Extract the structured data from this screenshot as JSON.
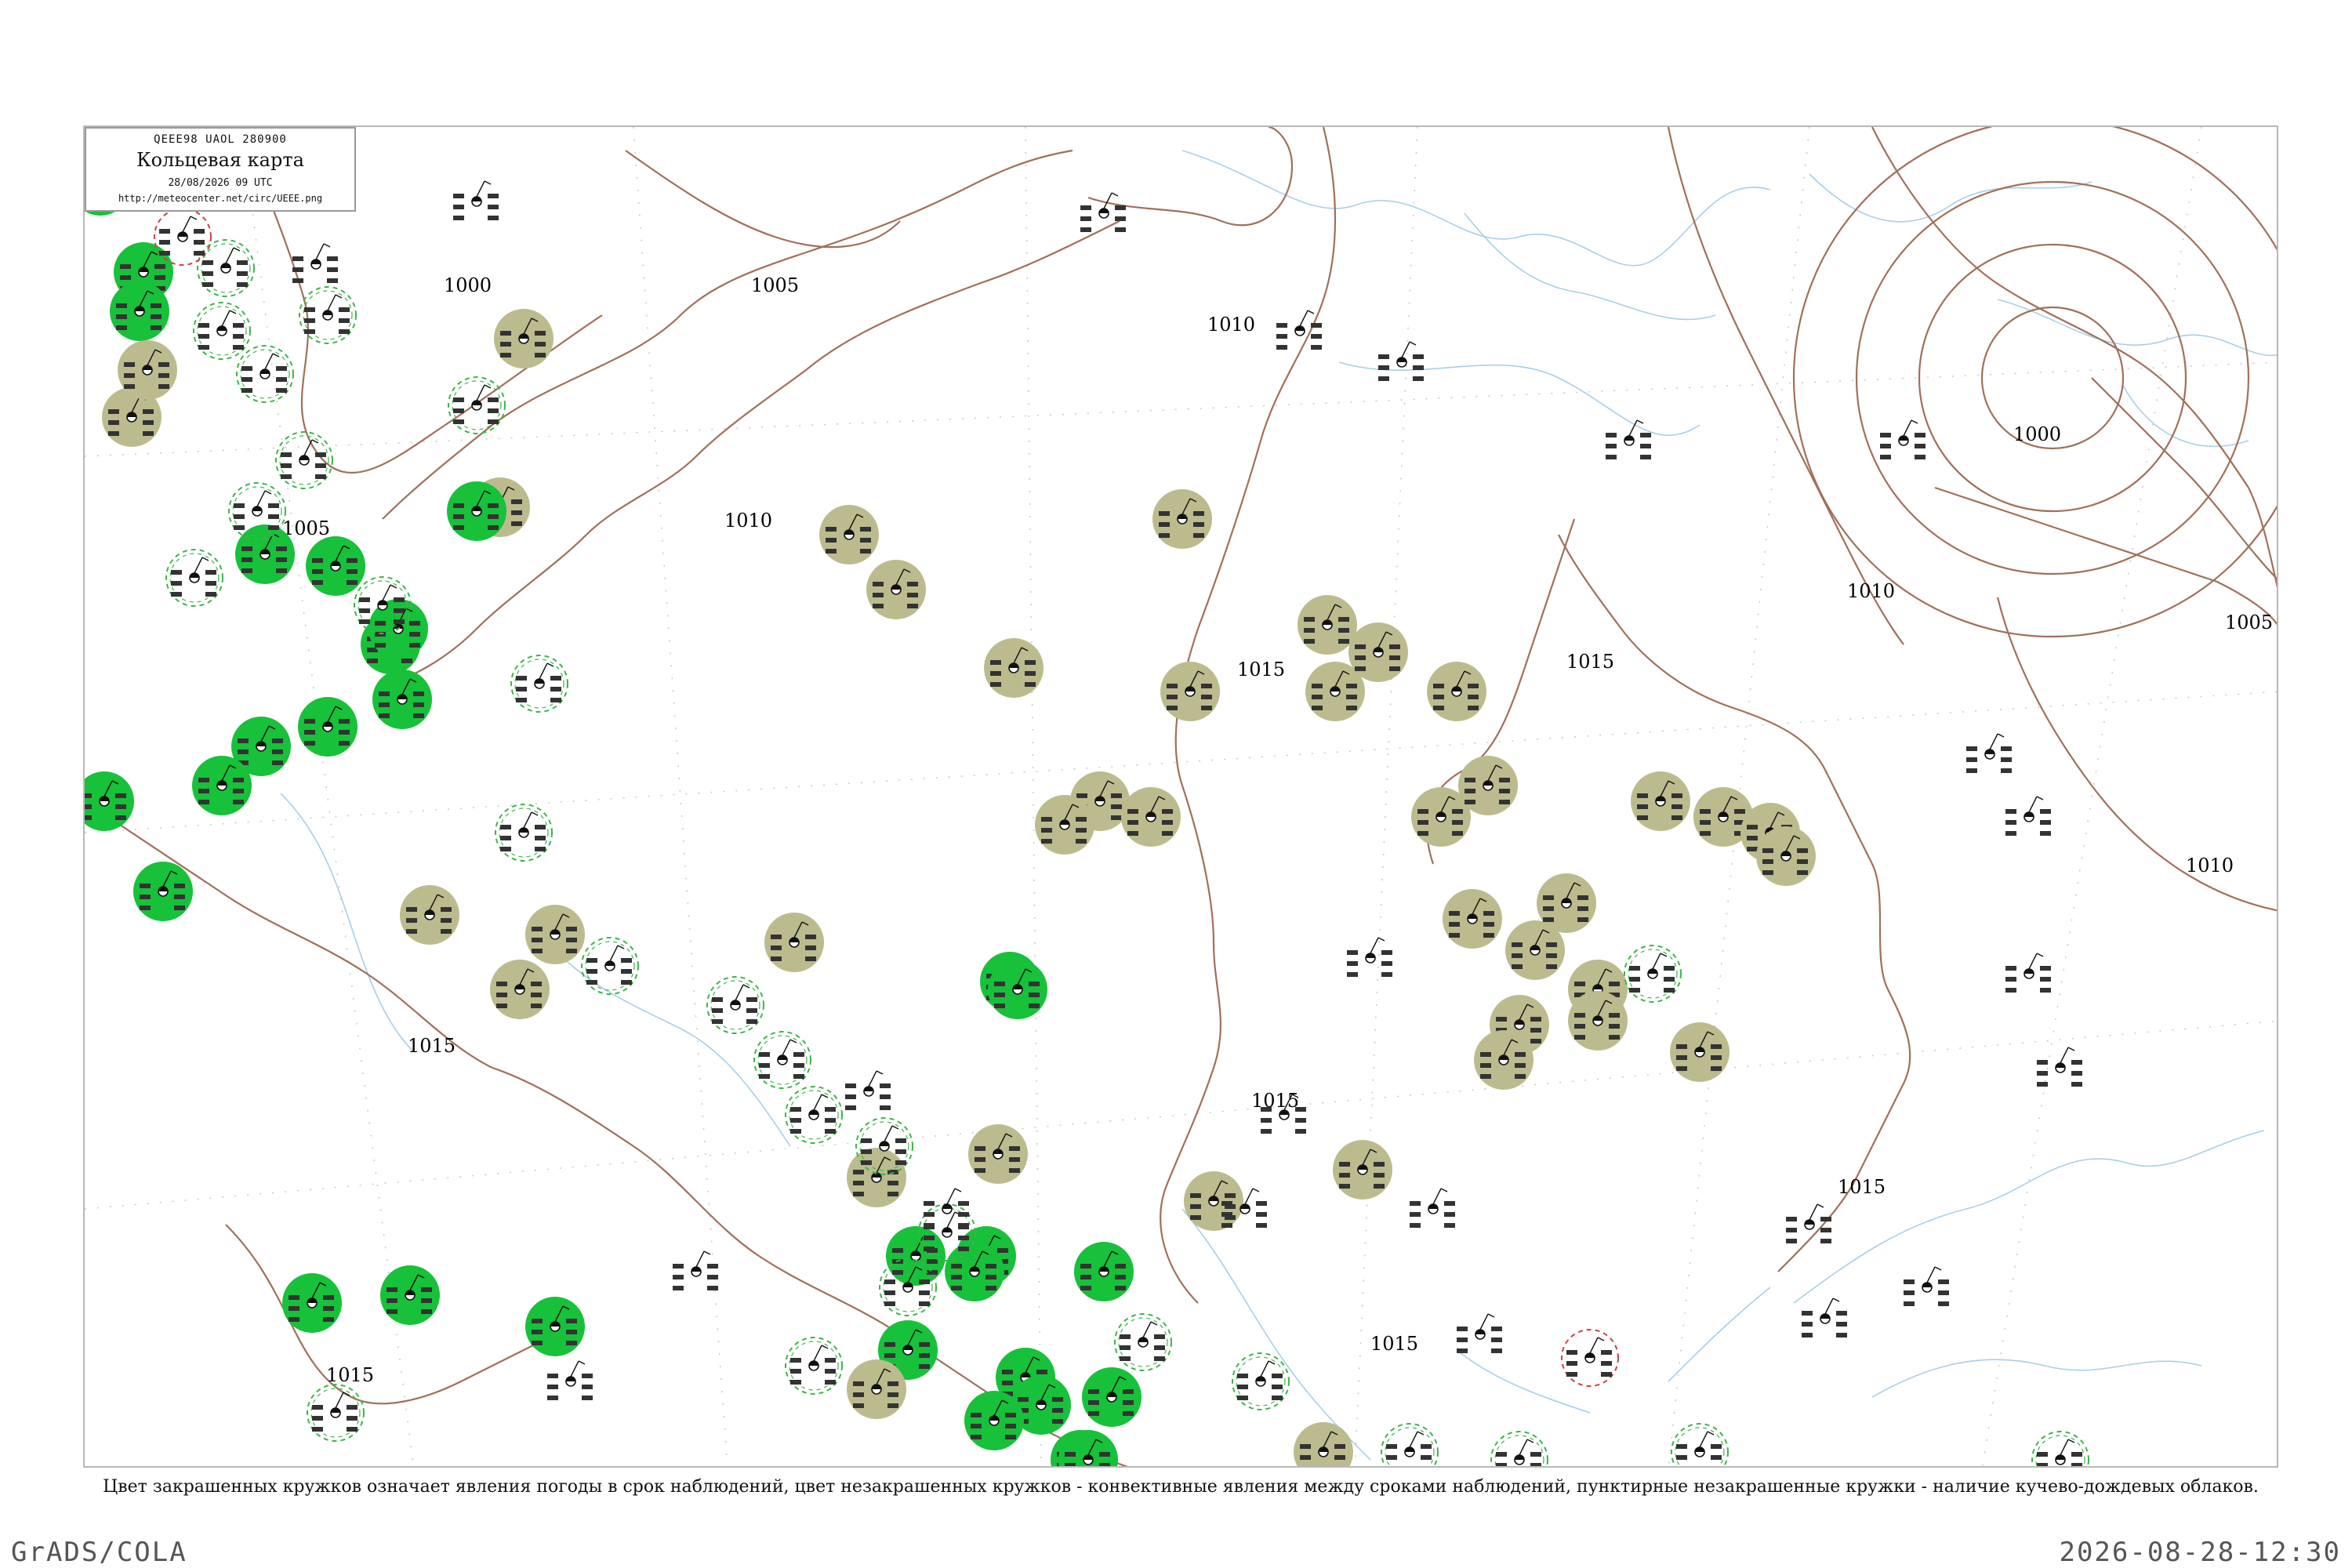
{
  "legend": {
    "code": "QEEE98  UAOL  280900",
    "title": "Кольцевая карта",
    "date": "28/08/2026 09 UTC",
    "url": "http://meteocenter.net/circ/UEEE.png"
  },
  "caption": "Цвет закрашенных кружков означает явления погоды в срок наблюдений, цвет незакрашенных кружков - конвективные явления между сроками наблюдений, пунктирные незакрашенные кружки - наличие кучево-дождевых облаков.",
  "footer": {
    "left": "GrADS/COLA",
    "right": "2026-08-28-12:30"
  },
  "colors": {
    "isobar": "#a0705a",
    "coast": "#a8cfe8",
    "filled_green": "#17c13a",
    "filled_olive": "#bcbb8e",
    "dashed_ring": "#3cb54a",
    "alert_ring": "#d04040",
    "graticule": "#c8c8c8"
  },
  "isobar_labels": [
    "1000",
    "1005",
    "1010",
    "1015"
  ],
  "stations": [
    {
      "kind": "filled_green"
    },
    {
      "kind": "filled_green"
    },
    {
      "kind": "filled_green"
    },
    {
      "kind": "filled_olive"
    },
    {
      "kind": "dashed_green"
    },
    {
      "kind": "filled_green"
    },
    {
      "kind": "filled_olive"
    },
    {
      "kind": "filled_olive"
    },
    {
      "kind": "filled_olive"
    },
    {
      "kind": "filled_olive"
    },
    {
      "kind": "filled_olive"
    },
    {
      "kind": "filled_olive"
    },
    {
      "kind": "filled_olive"
    },
    {
      "kind": "filled_olive"
    },
    {
      "kind": "filled_olive"
    },
    {
      "kind": "filled_olive"
    },
    {
      "kind": "filled_olive"
    },
    {
      "kind": "filled_olive"
    },
    {
      "kind": "filled_olive"
    },
    {
      "kind": "filled_olive"
    },
    {
      "kind": "filled_olive"
    },
    {
      "kind": "filled_olive"
    },
    {
      "kind": "filled_olive"
    },
    {
      "kind": "filled_olive"
    },
    {
      "kind": "filled_olive"
    },
    {
      "kind": "filled_olive"
    },
    {
      "kind": "filled_olive"
    },
    {
      "kind": "filled_olive"
    },
    {
      "kind": "filled_olive"
    },
    {
      "kind": "filled_olive"
    },
    {
      "kind": "filled_olive"
    },
    {
      "kind": "filled_olive"
    },
    {
      "kind": "filled_olive"
    },
    {
      "kind": "filled_olive"
    },
    {
      "kind": "filled_olive"
    },
    {
      "kind": "filled_olive"
    },
    {
      "kind": "filled_olive"
    },
    {
      "kind": "filled_olive"
    },
    {
      "kind": "filled_olive"
    },
    {
      "kind": "filled_green"
    },
    {
      "kind": "filled_green"
    },
    {
      "kind": "filled_green"
    },
    {
      "kind": "filled_green"
    },
    {
      "kind": "filled_green"
    },
    {
      "kind": "filled_green"
    },
    {
      "kind": "filled_green"
    },
    {
      "kind": "filled_green"
    },
    {
      "kind": "filled_green"
    },
    {
      "kind": "filled_green"
    },
    {
      "kind": "filled_green"
    },
    {
      "kind": "filled_green"
    },
    {
      "kind": "filled_green"
    },
    {
      "kind": "filled_green"
    },
    {
      "kind": "filled_green"
    },
    {
      "kind": "filled_green"
    },
    {
      "kind": "filled_green"
    },
    {
      "kind": "filled_green"
    },
    {
      "kind": "filled_green"
    },
    {
      "kind": "filled_green"
    },
    {
      "kind": "filled_green"
    },
    {
      "kind": "filled_green"
    },
    {
      "kind": "filled_green"
    },
    {
      "kind": "filled_green"
    },
    {
      "kind": "filled_green"
    },
    {
      "kind": "filled_green"
    },
    {
      "kind": "filled_green"
    },
    {
      "kind": "filled_olive"
    },
    {
      "kind": "filled_olive"
    },
    {
      "kind": "filled_olive"
    },
    {
      "kind": "filled_olive"
    },
    {
      "kind": "filled_olive"
    },
    {
      "kind": "filled_olive"
    },
    {
      "kind": "dashed_green"
    },
    {
      "kind": "dashed_green"
    },
    {
      "kind": "dashed_green"
    },
    {
      "kind": "dashed_green"
    },
    {
      "kind": "dashed_green"
    },
    {
      "kind": "dashed_green"
    },
    {
      "kind": "dashed_green"
    },
    {
      "kind": "dashed_green"
    },
    {
      "kind": "dashed_green"
    },
    {
      "kind": "dashed_green"
    },
    {
      "kind": "dashed_green"
    },
    {
      "kind": "dashed_green"
    },
    {
      "kind": "dashed_green"
    },
    {
      "kind": "dashed_green"
    },
    {
      "kind": "dashed_green"
    },
    {
      "kind": "dashed_green"
    },
    {
      "kind": "dashed_green"
    },
    {
      "kind": "dashed_green"
    },
    {
      "kind": "dashed_green"
    },
    {
      "kind": "dashed_green"
    },
    {
      "kind": "dashed_green"
    },
    {
      "kind": "dashed_green"
    },
    {
      "kind": "dashed_green"
    },
    {
      "kind": "dashed_green"
    },
    {
      "kind": "dashed_green"
    },
    {
      "kind": "dashed_green"
    },
    {
      "kind": "dashed_red"
    },
    {
      "kind": "dashed_red"
    },
    {
      "kind": "plain"
    },
    {
      "kind": "plain"
    },
    {
      "kind": "plain"
    },
    {
      "kind": "plain"
    },
    {
      "kind": "plain"
    },
    {
      "kind": "plain"
    },
    {
      "kind": "plain"
    },
    {
      "kind": "plain"
    },
    {
      "kind": "plain"
    },
    {
      "kind": "plain"
    },
    {
      "kind": "plain"
    },
    {
      "kind": "plain"
    },
    {
      "kind": "plain"
    },
    {
      "kind": "plain"
    },
    {
      "kind": "plain"
    },
    {
      "kind": "plain"
    },
    {
      "kind": "plain"
    },
    {
      "kind": "plain"
    },
    {
      "kind": "plain"
    },
    {
      "kind": "plain"
    },
    {
      "kind": "plain"
    },
    {
      "kind": "plain"
    },
    {
      "kind": "plain"
    },
    {
      "kind": "plain"
    }
  ]
}
